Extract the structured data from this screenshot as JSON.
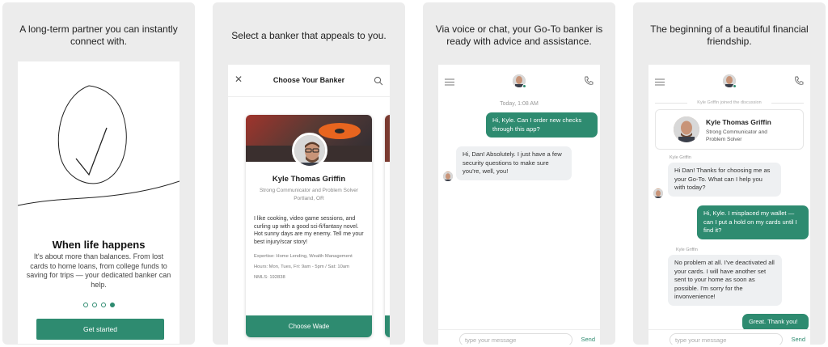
{
  "panel1": {
    "caption": "A long-term partner you can instantly connect with.",
    "title": "When life happens",
    "body": "It's about more than balances. From lost cards to home loans, from college funds to saving for trips — your dedicated banker can help.",
    "cta": "Get started",
    "page_indicator": {
      "total": 4,
      "active": 4
    }
  },
  "panel2": {
    "caption": "Select a banker that appeals to you.",
    "header_title": "Choose Your Banker",
    "banker": {
      "name": "Kyle Thomas Griffin",
      "role": "Strong Communicator and Problem Solver",
      "location": "Portland, OR",
      "bio": "I like cooking, video game sessions, and curling up with a good sci-fi/fantasy novel. Hot sunny days are my enemy. Tell me your best injury/scar story!",
      "expertise": "Expertise: Home Lending, Wealth Management",
      "hours": "Hours: Mon, Tues, Fri: 9am - 5pm / Sat: 10am",
      "nmls": "NMLS: 192838"
    },
    "choose_button": "Choose Wade"
  },
  "panel3": {
    "caption": "Via voice or chat, your Go-To banker is ready with advice and assistance.",
    "timestamp": "Today, 1:08 AM",
    "messages": [
      {
        "from": "user",
        "text": "Hi, Kyle. Can I order new checks through this app?"
      },
      {
        "from": "banker",
        "text": "Hi, Dan! Absolutely. I just have a few security questions to make sure you're, well, you!"
      }
    ],
    "input_placeholder": "type your message",
    "send_label": "Send"
  },
  "panel4": {
    "caption": "The beginning of a beautiful financial friendship.",
    "joined_text": "Kyle Griffin joined the discussion",
    "banker_name": "Kyle Thomas Griffin",
    "banker_role": "Strong Communicator and Problem Solver",
    "messages": [
      {
        "from": "banker",
        "sender": "Kyle Griffin",
        "text": "Hi Dan! Thanks for choosing me as your Go-To. What can I help you with today?"
      },
      {
        "from": "user",
        "text": "Hi, Kyle. I misplaced my wallet — can I put a hold on my cards until I find it?"
      },
      {
        "from": "banker",
        "sender": "Kyle Griffin",
        "text": "No problem at all. I've deactivated all your cards. I will have another set sent to your home as soon as possible. I'm sorry for the invonvenience!"
      },
      {
        "from": "user",
        "text": "Great. Thank you!"
      }
    ],
    "input_placeholder": "type your message",
    "send_label": "Send"
  },
  "colors": {
    "accent": "#2e8b70",
    "panel_bg": "#ececec",
    "bubble_in": "#eef0f2"
  }
}
